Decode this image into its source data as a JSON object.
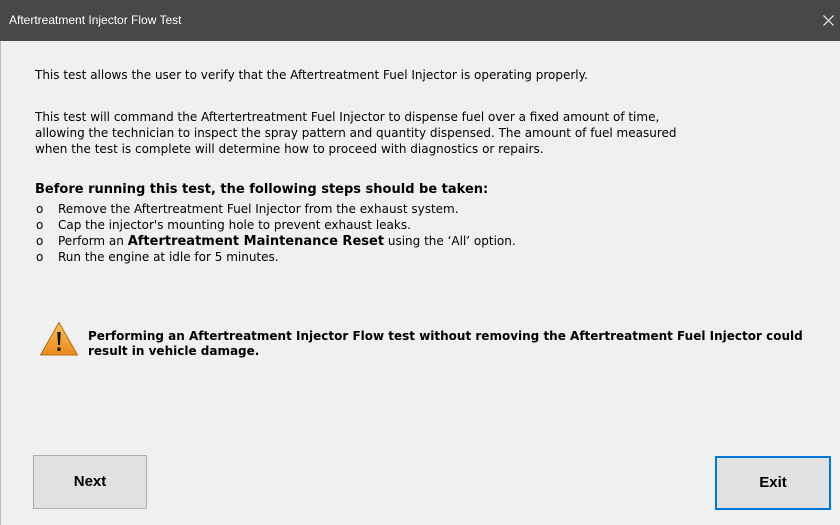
{
  "window": {
    "title": "Aftertreatment Injector Flow Test",
    "close_glyph": "✕",
    "titlebar_color": "#474747",
    "background_color": "#f0f0f0"
  },
  "body": {
    "intro": "This test allows the user to verify that the Aftertreatment Fuel Injector is operating properly.",
    "description_lines": [
      "This test will command the Aftertertreatment Fuel Injector to dispense fuel over a fixed amount of time,",
      "allowing the technician to inspect the spray pattern and quantity dispensed. The amount of fuel measured",
      "when the test is complete will determine how to proceed with diagnostics or repairs."
    ],
    "steps_heading": "Before running this test, the following steps should be taken:",
    "bullet": "o",
    "steps": [
      {
        "text": "Remove the Aftertreatment Fuel Injector from the exhaust system."
      },
      {
        "text": "Cap the injector's mounting hole to prevent exhaust leaks."
      },
      {
        "before": "Perform an ",
        "bold": "Aftertreatment Maintenance Reset",
        "after": " using the ‘All’ option."
      },
      {
        "text": "Run the engine at idle for 5 minutes."
      }
    ]
  },
  "warning": {
    "icon": "warning-triangle-icon",
    "icon_color": "#f2a33a",
    "text": "Performing an Aftertreatment Injector Flow test without removing the Aftertreatment Fuel Injector could result in vehicle damage."
  },
  "buttons": {
    "next_label": "Next",
    "exit_label": "Exit",
    "focus_color": "#0078d7"
  }
}
